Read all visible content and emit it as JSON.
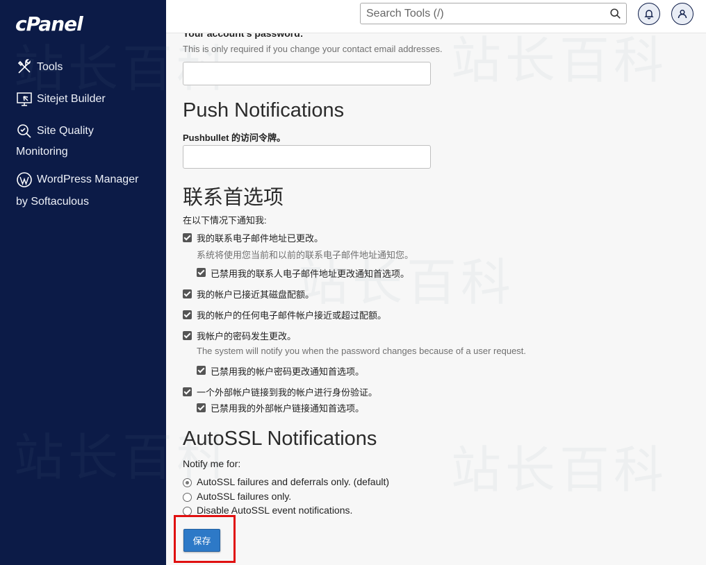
{
  "sidebar": {
    "logo": "cPanel",
    "items": [
      {
        "label": "Tools",
        "icon": "tools-icon"
      },
      {
        "label": "Sitejet Builder",
        "icon": "sitejet-icon"
      },
      {
        "label": "Site Quality",
        "label2": "Monitoring",
        "icon": "site-quality-icon"
      },
      {
        "label": "WordPress Manager",
        "label2": "by Softaculous",
        "icon": "wordpress-icon"
      }
    ]
  },
  "topbar": {
    "search_placeholder": "Search Tools (/)"
  },
  "form": {
    "password_label": "Your account's password:",
    "password_help": "This is only required if you change your contact email addresses.",
    "push_heading": "Push Notifications",
    "pushbullet_label": "Pushbullet 的访问令牌。",
    "contact_heading": "联系首选项",
    "notify_when": "在以下情况下通知我:",
    "options": [
      {
        "label": "我的联系电子邮件地址已更改。",
        "checked": true
      },
      {
        "help": "系统将使用您当前和以前的联系电子邮件地址通知您。"
      },
      {
        "label": "已禁用我的联系人电子邮件地址更改通知首选项。",
        "checked": true
      },
      {
        "label": "我的帐户已接近其磁盘配额。",
        "checked": true
      },
      {
        "label": "我的帐户的任何电子邮件帐户接近或超过配额。",
        "checked": true
      },
      {
        "label": "我帐户的密码发生更改。",
        "checked": true
      },
      {
        "help": "The system will notify you when the password changes because of a user request."
      },
      {
        "label": "已禁用我的帐户密码更改通知首选项。",
        "checked": true
      },
      {
        "label": "一个外部帐户链接到我的帐户进行身份验证。",
        "checked": true
      },
      {
        "label": "已禁用我的外部帐户链接通知首选项。",
        "checked": true
      }
    ],
    "autossl_heading": "AutoSSL Notifications",
    "notify_me_for": "Notify me for:",
    "radios": [
      {
        "label": "AutoSSL failures and deferrals only. (default)",
        "selected": true
      },
      {
        "label": "AutoSSL failures only.",
        "selected": false
      },
      {
        "label": "Disable AutoSSL event notifications.",
        "selected": false
      }
    ],
    "save_label": "保存"
  },
  "watermark": "站长百科",
  "colors": {
    "sidebar_bg": "#0c1b47",
    "button_blue": "#2d79c7",
    "highlight_red": "#e01010"
  }
}
